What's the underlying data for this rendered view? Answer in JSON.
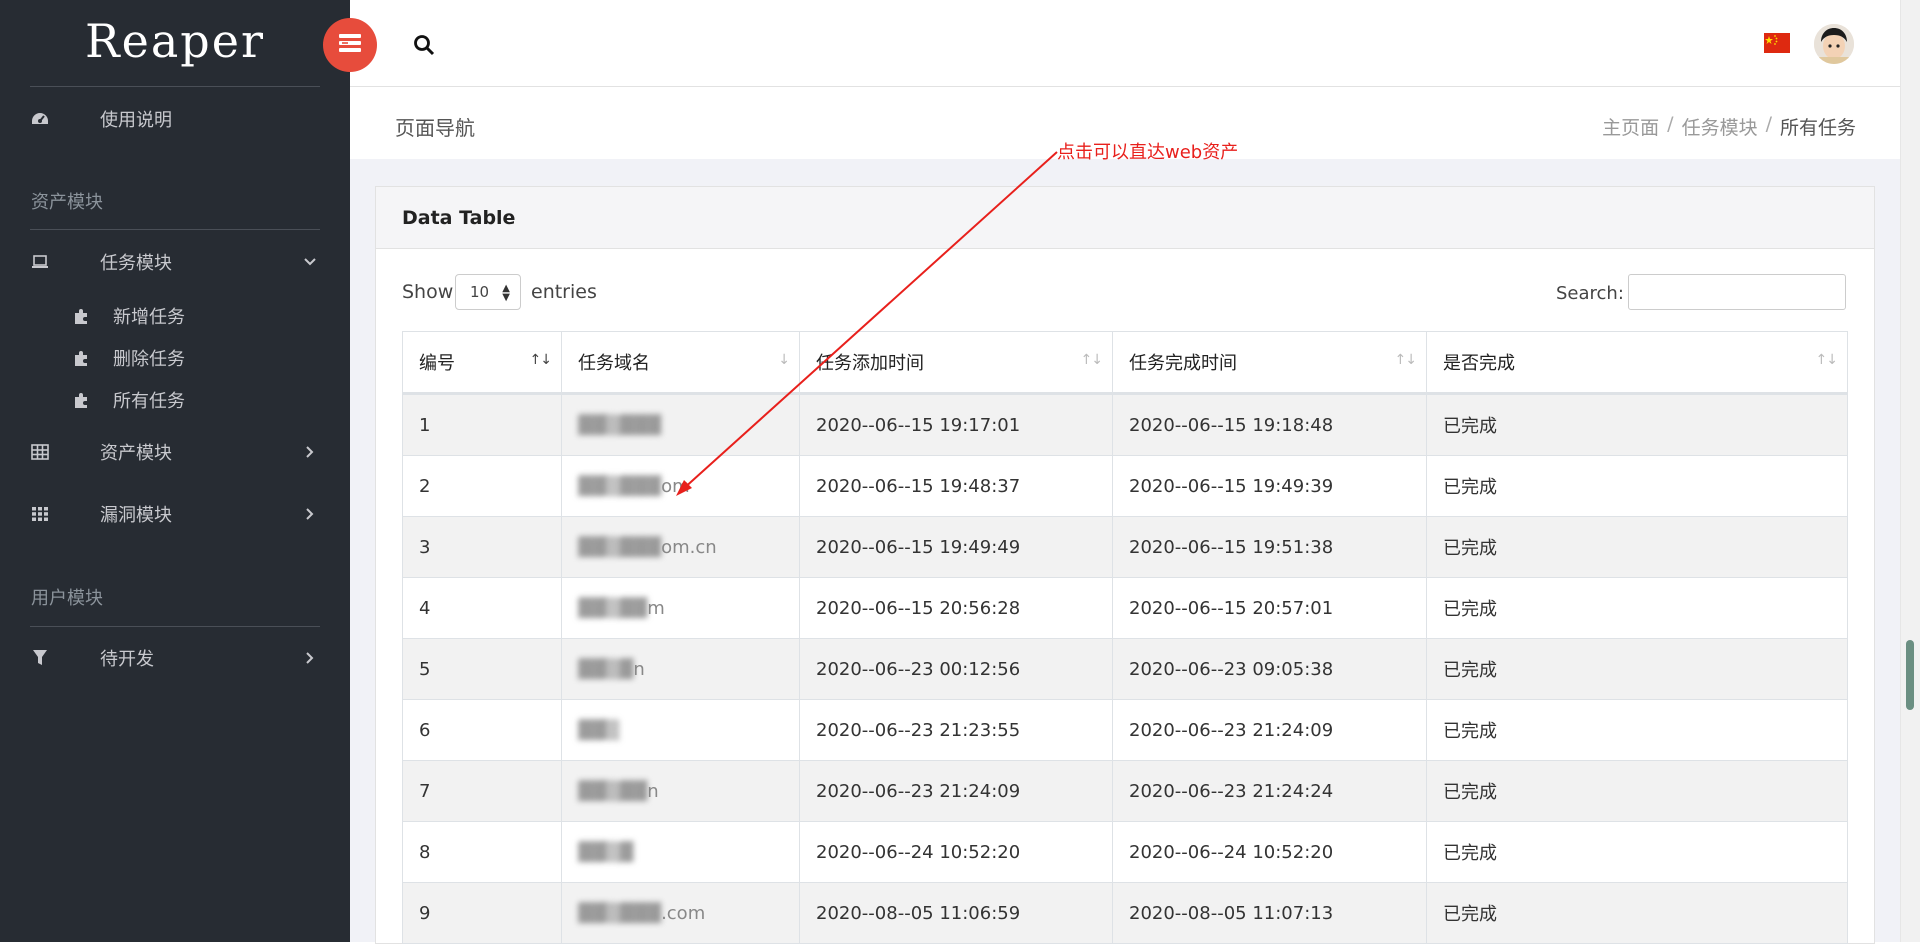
{
  "app": {
    "logo": "Reaper"
  },
  "sidebar": {
    "items": [
      {
        "label": "使用说明",
        "icon": "dashboard-icon"
      },
      {
        "label": "任务模块",
        "icon": "laptop-icon"
      },
      {
        "label": "资产模块",
        "icon": "table-icon"
      },
      {
        "label": "漏洞模块",
        "icon": "grid-icon"
      },
      {
        "label": "待开发",
        "icon": "filter-icon"
      }
    ],
    "sections": [
      "资产模块",
      "用户模块"
    ],
    "subitems": [
      {
        "label": "新增任务",
        "icon": "puzzle-icon"
      },
      {
        "label": "删除任务",
        "icon": "puzzle-icon"
      },
      {
        "label": "所有任务",
        "icon": "puzzle-icon"
      }
    ]
  },
  "header": {
    "menu_icon": "menu-icon",
    "search_icon": "search-icon",
    "flag_icon": "china-flag-icon",
    "avatar_icon": "avatar-icon"
  },
  "page": {
    "title": "页面导航",
    "breadcrumb": [
      "主页面",
      "任务模块",
      "所有任务"
    ]
  },
  "card": {
    "title": "Data Table",
    "show_label": "Show",
    "entries_value": "10",
    "entries_label": "entries",
    "search_label": "Search:"
  },
  "annotation": {
    "text": "点击可以直达web资产",
    "color": "#e8201c"
  },
  "table": {
    "headers": [
      "编号",
      "任务域名",
      "任务添加时间",
      "任务完成时间",
      "是否完成"
    ],
    "rows": [
      {
        "id": "1",
        "domain_tail": "",
        "added": "2020--06--15 19:17:01",
        "done": "2020--06--15 19:18:48",
        "status": "已完成"
      },
      {
        "id": "2",
        "domain_tail": "om",
        "added": "2020--06--15 19:48:37",
        "done": "2020--06--15 19:49:39",
        "status": "已完成"
      },
      {
        "id": "3",
        "domain_tail": "om.cn",
        "added": "2020--06--15 19:49:49",
        "done": "2020--06--15 19:51:38",
        "status": "已完成"
      },
      {
        "id": "4",
        "domain_tail": "m",
        "added": "2020--06--15 20:56:28",
        "done": "2020--06--15 20:57:01",
        "status": "已完成"
      },
      {
        "id": "5",
        "domain_tail": "n",
        "added": "2020--06--23 00:12:56",
        "done": "2020--06--23 09:05:38",
        "status": "已完成"
      },
      {
        "id": "6",
        "domain_tail": "",
        "added": "2020--06--23 21:23:55",
        "done": "2020--06--23 21:24:09",
        "status": "已完成"
      },
      {
        "id": "7",
        "domain_tail": "n",
        "added": "2020--06--23 21:24:09",
        "done": "2020--06--23 21:24:24",
        "status": "已完成"
      },
      {
        "id": "8",
        "domain_tail": "",
        "added": "2020--06--24 10:52:20",
        "done": "2020--06--24 10:52:20",
        "status": "已完成"
      },
      {
        "id": "9",
        "domain_tail": ".com",
        "added": "2020--08--05 11:06:59",
        "done": "2020--08--05 11:07:13",
        "status": "已完成"
      }
    ]
  }
}
